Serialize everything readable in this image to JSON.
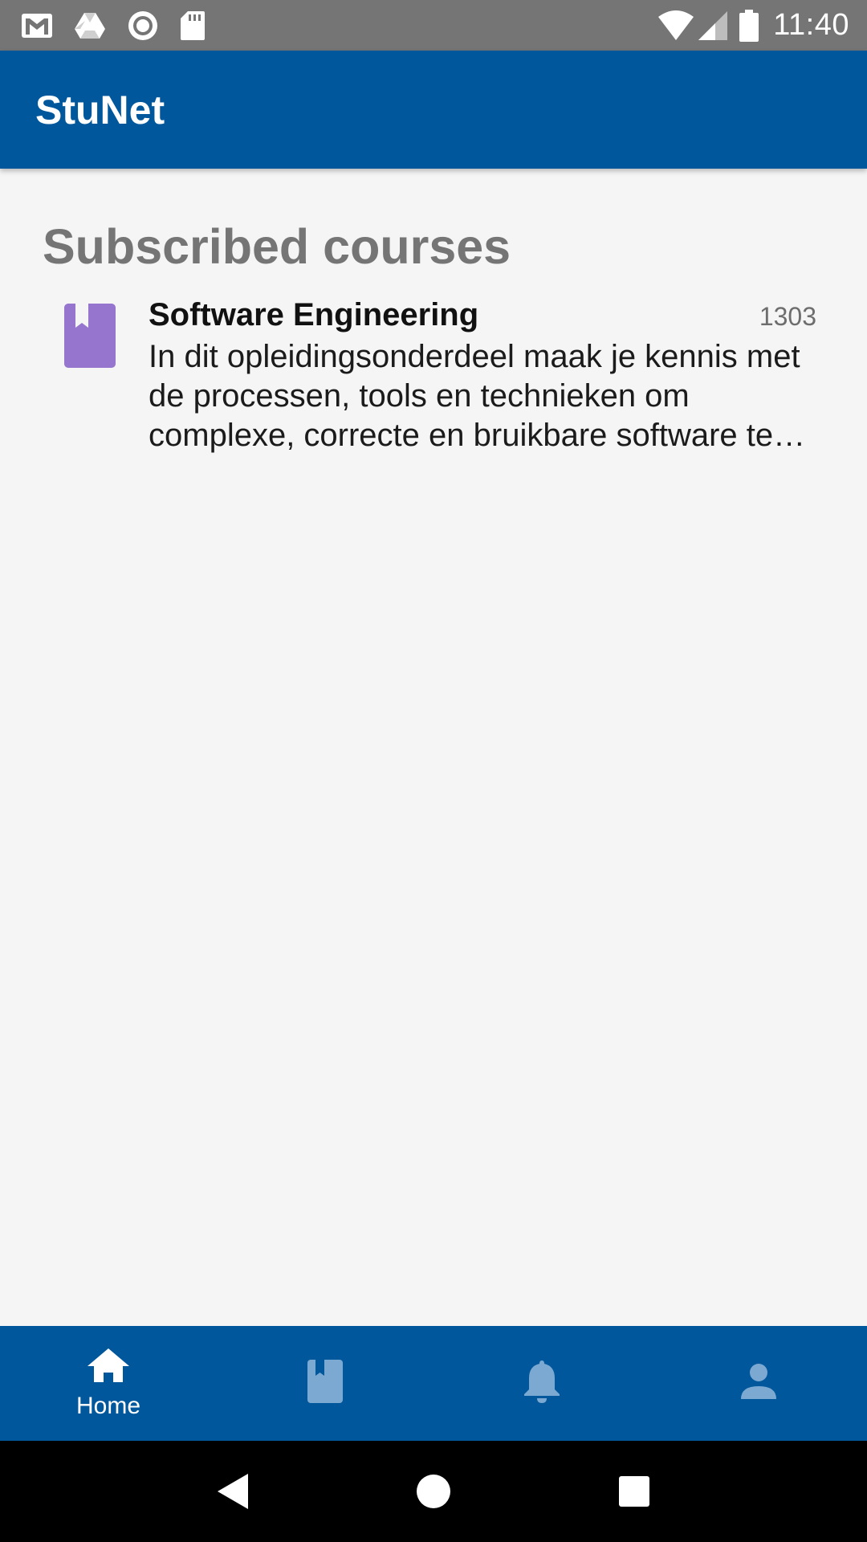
{
  "status_bar": {
    "time": "11:40",
    "left_icons": [
      "gmail-icon",
      "drive-icon",
      "record-icon",
      "sd-card-icon"
    ],
    "right_icons": [
      "wifi-icon",
      "signal-icon",
      "battery-icon"
    ]
  },
  "app_bar": {
    "title": "StuNet"
  },
  "main": {
    "section_title": "Subscribed courses",
    "courses": [
      {
        "icon": "book-icon",
        "name": "Software Engineering",
        "code": "1303",
        "description": "In dit opleidingsonderdeel maak je kennis met de processen, tools en technieken om complexe, correcte en bruikbare software te ontwikkelen."
      }
    ]
  },
  "bottom_nav": {
    "items": [
      {
        "icon": "home-icon",
        "label": "Home",
        "active": true
      },
      {
        "icon": "book-icon",
        "label": "",
        "active": false
      },
      {
        "icon": "bell-icon",
        "label": "",
        "active": false
      },
      {
        "icon": "person-icon",
        "label": "",
        "active": false
      }
    ]
  },
  "system_nav": {
    "buttons": [
      "back-icon",
      "home-circle-icon",
      "recents-icon"
    ]
  },
  "colors": {
    "primary": "#01579b",
    "status_bar": "#757575",
    "course_icon": "#9575cd",
    "inactive_nav_icon": "#7ba9d2",
    "background": "#f5f5f5"
  }
}
